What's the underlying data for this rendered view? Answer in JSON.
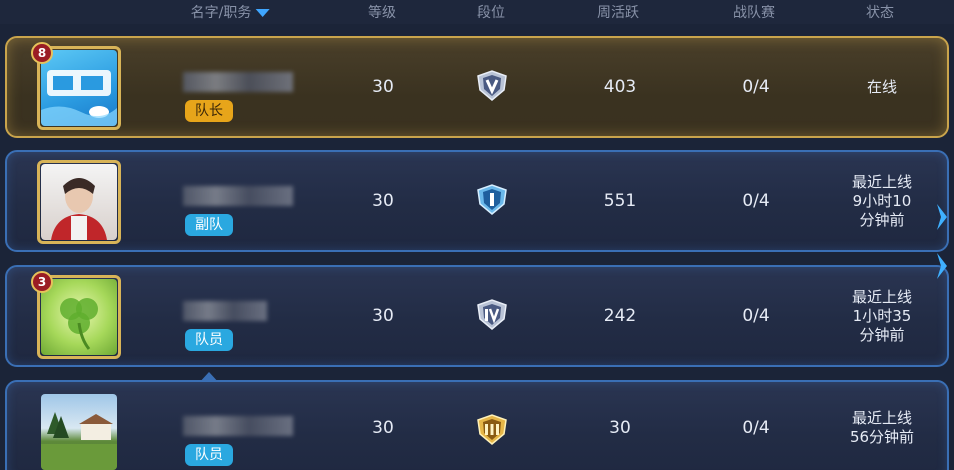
{
  "columns": {
    "name_role": "名字/职务",
    "level": "等级",
    "rank": "段位",
    "weekly_activity": "周活跃",
    "team_battle": "战队赛",
    "status": "状态"
  },
  "colors": {
    "leader_border": "#c9a44c",
    "member_border": "#3a6fb5",
    "role_leader": "#e7a51a",
    "role_member": "#2aa8e0"
  },
  "members": [
    {
      "avatar_icon": "taoqiao-logo-avatar",
      "avatar_level": "8",
      "role": "队长",
      "level": "30",
      "rank_icon": "rank-badge-v-silver",
      "weekly": "403",
      "team": "0/4",
      "status_lines": [
        "在线"
      ]
    },
    {
      "avatar_icon": "kpl-player-avatar",
      "avatar_level": "",
      "role": "副队",
      "level": "30",
      "rank_icon": "rank-badge-i-blue",
      "weekly": "551",
      "team": "0/4",
      "status_lines": [
        "最近上线",
        "9小时10",
        "分钟前"
      ]
    },
    {
      "avatar_icon": "clover-avatar",
      "avatar_level": "3",
      "role": "队员",
      "level": "30",
      "rank_icon": "rank-badge-iv-silver",
      "weekly": "242",
      "team": "0/4",
      "status_lines": [
        "最近上线",
        "1小时35",
        "分钟前"
      ]
    },
    {
      "avatar_icon": "landscape-avatar",
      "avatar_level": "",
      "role": "队员",
      "level": "30",
      "rank_icon": "rank-badge-iii-gold",
      "weekly": "30",
      "team": "0/4",
      "status_lines": [
        "最近上线",
        "56分钟前"
      ]
    }
  ]
}
